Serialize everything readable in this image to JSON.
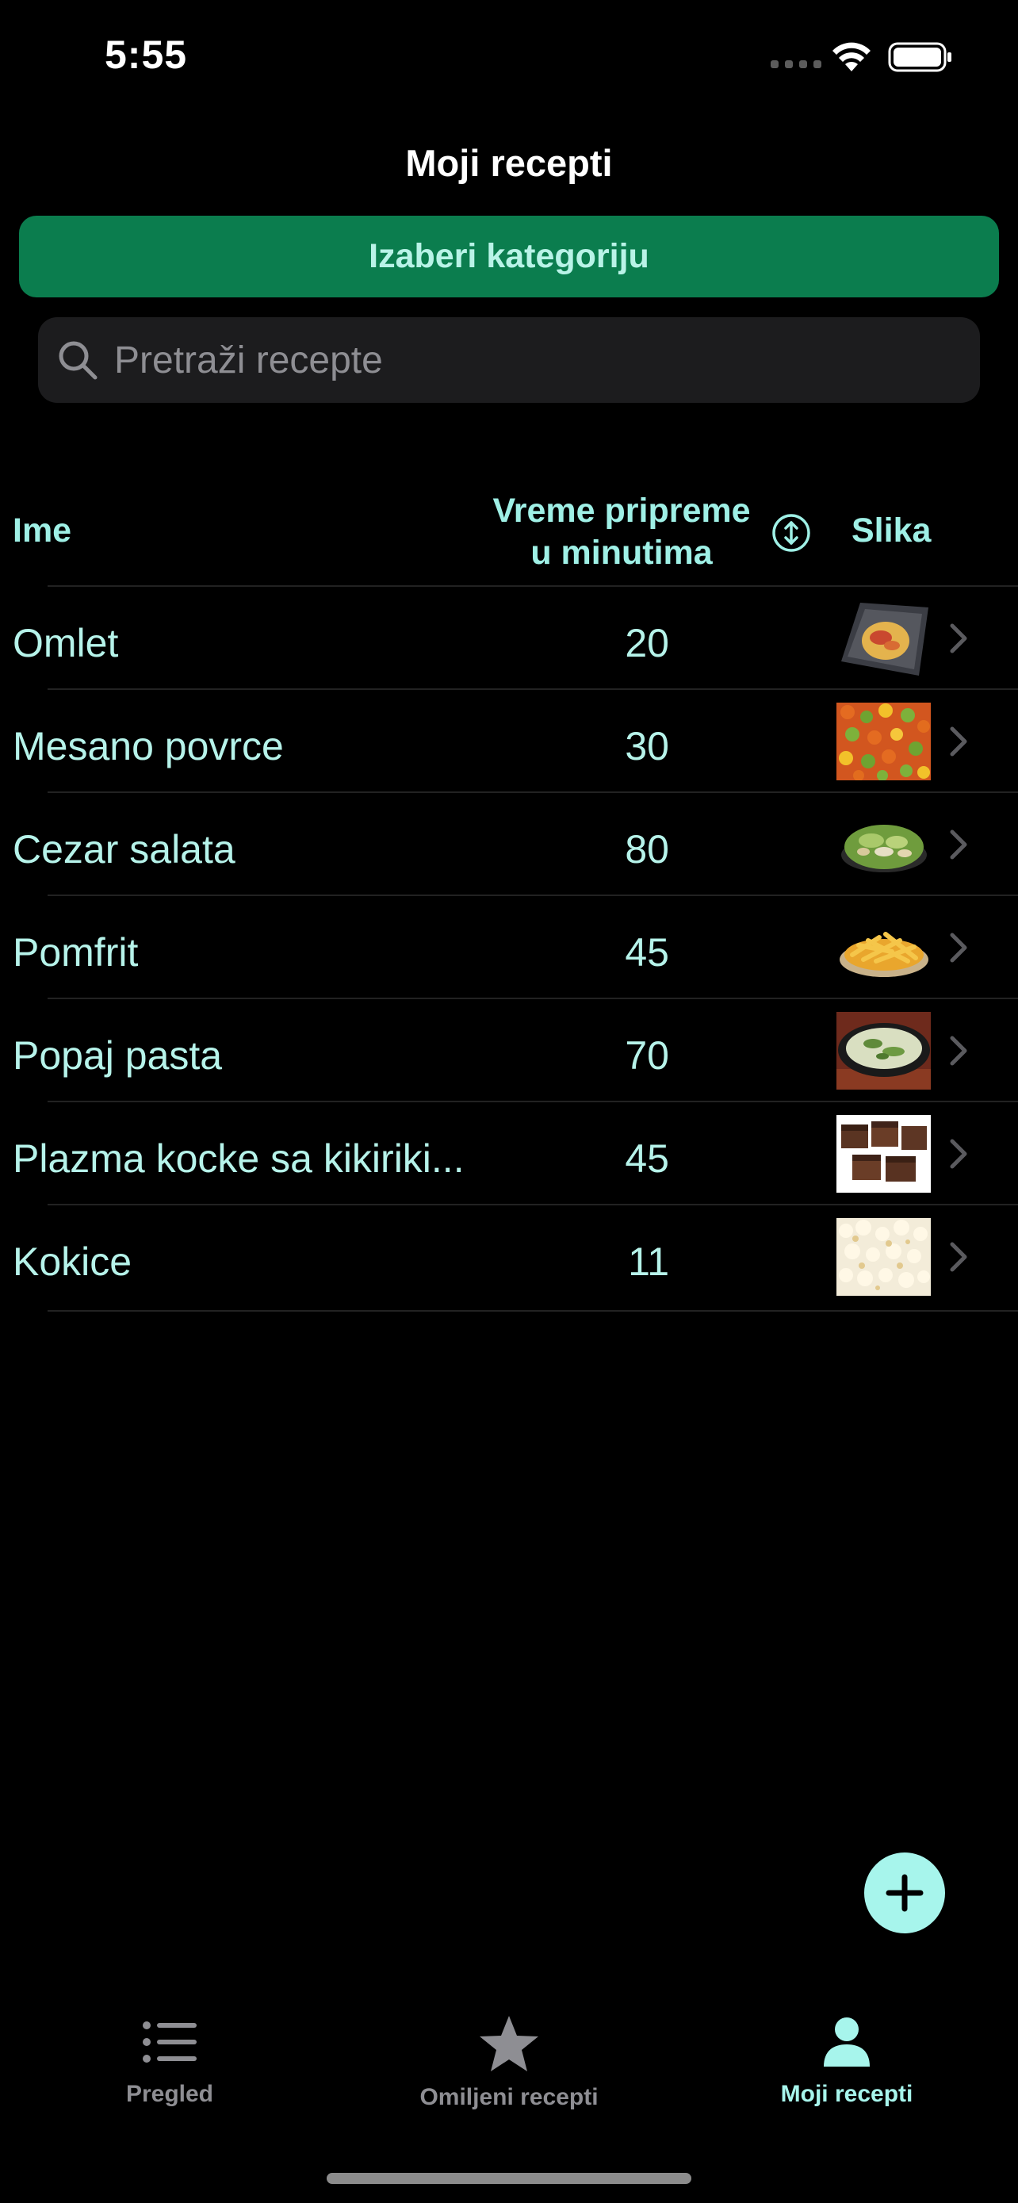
{
  "status_bar": {
    "time": "5:55"
  },
  "header": {
    "title": "Moji recepti"
  },
  "category_button": {
    "label": "Izaberi kategoriju"
  },
  "search": {
    "placeholder": "Pretraži recepte",
    "value": ""
  },
  "table": {
    "columns": {
      "name": "Ime",
      "time_line1": "Vreme pripreme",
      "time_line2": "u minutima",
      "image": "Slika"
    },
    "rows": [
      {
        "name": "Omlet",
        "time": "20",
        "image": "omelette-photo"
      },
      {
        "name": "Mesano povrce",
        "time": "30",
        "image": "mixed-vegetables-photo"
      },
      {
        "name": "Cezar salata",
        "time": "80",
        "image": "caesar-salad-photo"
      },
      {
        "name": "Pomfrit",
        "time": "45",
        "image": "french-fries-photo"
      },
      {
        "name": "Popaj pasta",
        "time": "70",
        "image": "spinach-pasta-photo"
      },
      {
        "name": "Plazma kocke sa kikiriki...",
        "time": "45",
        "image": "cake-cubes-photo"
      },
      {
        "name": "Kokice",
        "time": "11",
        "image": "popcorn-photo"
      }
    ]
  },
  "tabs": [
    {
      "label": "Pregled",
      "icon": "list-icon",
      "active": false
    },
    {
      "label": "Omiljeni recepti",
      "icon": "star-icon",
      "active": false
    },
    {
      "label": "Moji recepti",
      "icon": "person-icon",
      "active": true
    }
  ],
  "colors": {
    "accent": "#a7f5ec",
    "text_accent": "#b6f3ea",
    "button_green": "#0b7d4e",
    "inactive_tab": "#8e8e93"
  }
}
